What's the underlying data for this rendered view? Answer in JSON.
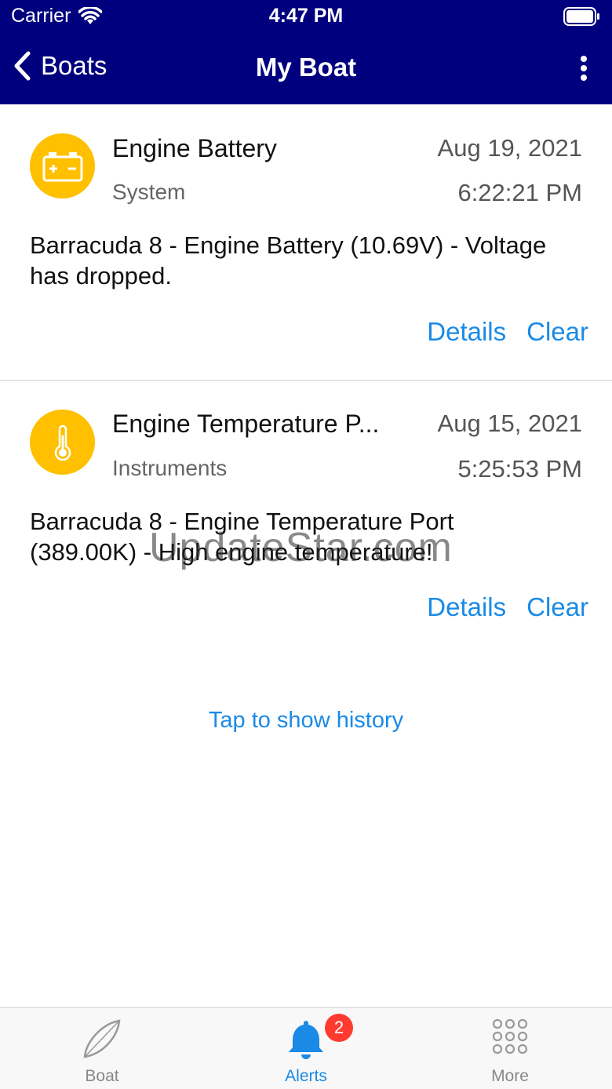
{
  "status_bar": {
    "carrier": "Carrier",
    "time": "4:47 PM",
    "wifi_icon": "wifi-icon",
    "battery_icon": "battery-icon"
  },
  "nav": {
    "back_label": "Boats",
    "title": "My Boat",
    "menu_icon": "more-vertical-icon"
  },
  "alerts": [
    {
      "icon": "battery-icon",
      "title": "Engine Battery",
      "category": "System",
      "date": "Aug 19, 2021",
      "time": "6:22:21 PM",
      "message": "Barracuda 8 - Engine Battery (10.69V) - Voltage has dropped.",
      "details_label": "Details",
      "clear_label": "Clear"
    },
    {
      "icon": "thermometer-icon",
      "title": "Engine Temperature P...",
      "category": "Instruments",
      "date": "Aug 15, 2021",
      "time": "5:25:53 PM",
      "message": "Barracuda 8 - Engine Temperature Port (389.00K) - High engine temperature!",
      "details_label": "Details",
      "clear_label": "Clear"
    }
  ],
  "history_link": "Tap to show history",
  "watermark": "UpdateStar.com",
  "tabbar": {
    "tabs": [
      {
        "label": "Boat",
        "icon": "boat-icon"
      },
      {
        "label": "Alerts",
        "icon": "bell-icon"
      },
      {
        "label": "More",
        "icon": "grid-icon"
      }
    ],
    "alerts_badge": "2"
  },
  "colors": {
    "nav_background": "#00007f",
    "accent": "#1a8ae6",
    "alert_icon_background": "#ffc000",
    "badge": "#ff3b30"
  }
}
